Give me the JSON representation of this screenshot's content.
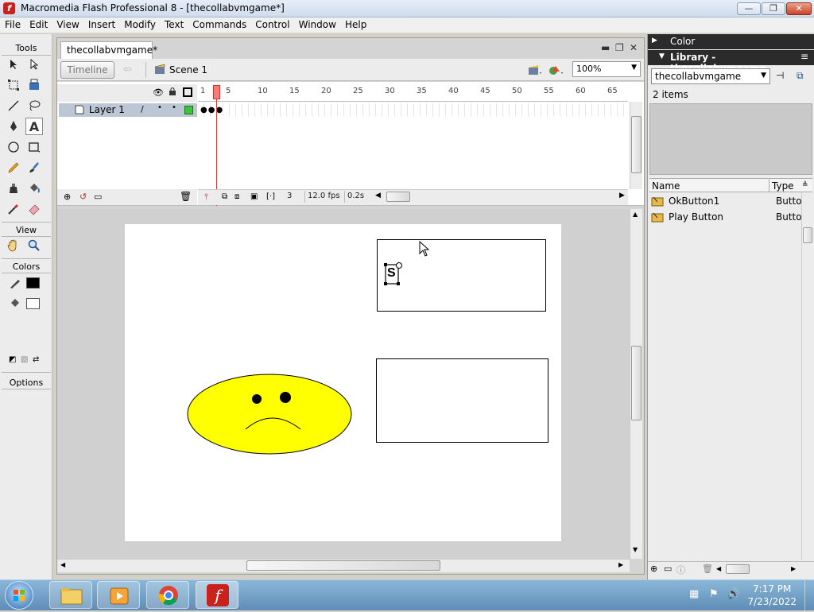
{
  "window": {
    "title": "Macromedia Flash Professional 8 - [thecollabvmgame*]",
    "app_icon": "flash-icon",
    "min": "—",
    "max": "❐",
    "close": "✕"
  },
  "menu": [
    "File",
    "Edit",
    "View",
    "Insert",
    "Modify",
    "Text",
    "Commands",
    "Control",
    "Window",
    "Help"
  ],
  "tools": {
    "header": "Tools",
    "view_header": "View",
    "colors_header": "Colors",
    "options_header": "Options"
  },
  "document": {
    "tab": "thecollabvmgame*",
    "min": "▬",
    "restore": "❐",
    "close": "✕",
    "timeline_button": "Timeline",
    "scene": "Scene 1",
    "zoom": "100%"
  },
  "timeline": {
    "layer_name": "Layer 1",
    "ruler_numbers": [
      "1",
      "5",
      "10",
      "15",
      "20",
      "25",
      "30",
      "35",
      "40",
      "45",
      "50",
      "55",
      "60",
      "65"
    ],
    "current_frame": "3",
    "fps": "12.0 fps",
    "elapsed": "0.2s"
  },
  "stage": {
    "text_glyph": "S",
    "colors": {
      "face_fill": "#ffff00",
      "stroke": "#000000",
      "stage": "#ffffff",
      "pasteboard": "#d0d0d0"
    }
  },
  "color_panel": {
    "title": "Color"
  },
  "library": {
    "title": "Library - thecollabvmgame",
    "selected": "thecollabvmgame",
    "count": "2 items",
    "columns": {
      "name": "Name",
      "type": "Type"
    },
    "items": [
      {
        "name": "OkButton1",
        "type": "Butto"
      },
      {
        "name": "Play Button",
        "type": "Butto"
      }
    ]
  },
  "taskbar": {
    "time": "7:17 PM",
    "date": "7/23/2022"
  }
}
